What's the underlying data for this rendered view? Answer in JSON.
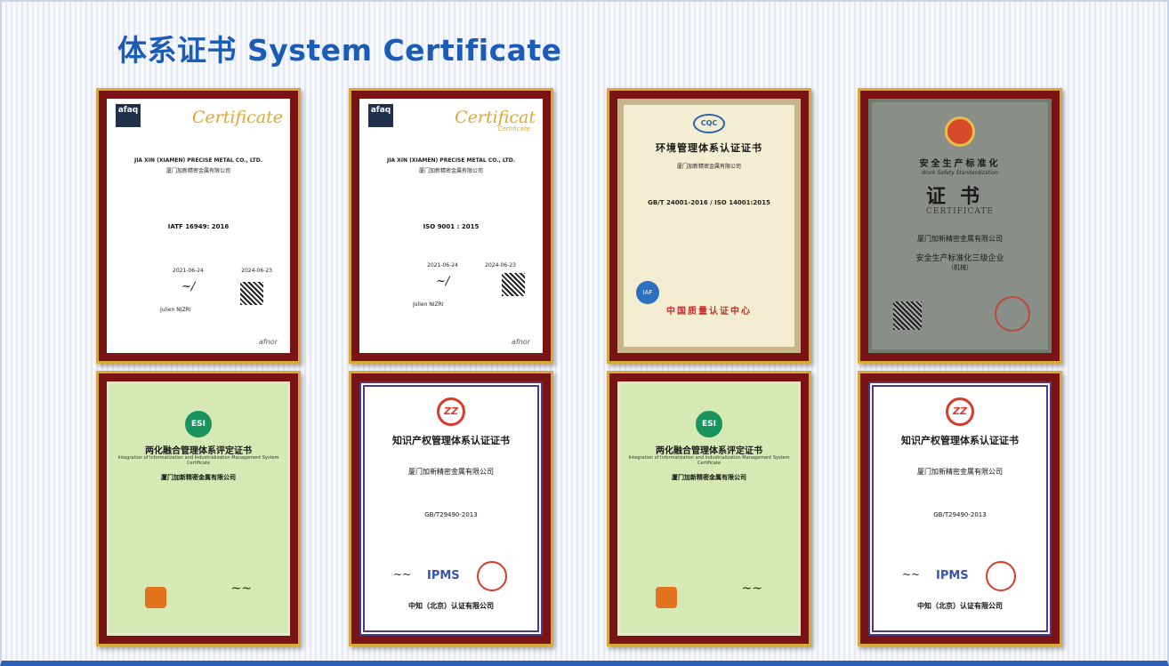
{
  "page": {
    "title": "体系证书 System Certificate"
  },
  "certificates": [
    {
      "issuer_logo": "afaq",
      "heading": "Certificate",
      "heading_sub": "",
      "company_en": "JIA XIN (XIAMEN) PRECISE METAL CO., LTD.",
      "company_cn": "厦门加新精密金属有限公司",
      "standard": "IATF 16949: 2016",
      "date_a": "2021-06-24",
      "date_b": "2024-06-23",
      "signer": "Julien NIZRI",
      "brand": "afnor"
    },
    {
      "issuer_logo": "afaq",
      "heading": "Certificat",
      "heading_sub": "Certificate",
      "company_en": "JIA XIN (XIAMEN) PRECISE METAL CO., LTD.",
      "company_cn": "厦门加新精密金属有限公司",
      "standard": "ISO 9001 : 2015",
      "date_a": "2021-06-24",
      "date_b": "2024-06-23",
      "signer": "Julien NIZRI",
      "brand": "afnor"
    },
    {
      "badge": "CQC",
      "heading": "环境管理体系认证证书",
      "company_cn": "厦门加新精密金属有限公司",
      "standard": "GB/T 24001-2016 / ISO 14001:2015",
      "mark": "IAF",
      "footer": "中国质量认证中心"
    },
    {
      "heading": "安全生产标准化",
      "heading_en": "Work Safety Standardization",
      "title_cn": "证书",
      "title_en": "CERTIFICATE",
      "company_cn": "厦门加新精密金属有限公司",
      "level": "安全生产标准化三级企业",
      "level_sub": "（机械）"
    },
    {
      "logo": "ESI",
      "heading": "两化融合管理体系评定证书",
      "heading_en": "Integration of Informatization and Industrialization Management System Certificate",
      "company_cn": "厦门加新精密金属有限公司"
    },
    {
      "logo": "ZZ",
      "heading": "知识产权管理体系认证证书",
      "company_cn": "厦门加新精密金属有限公司",
      "standard": "GB/T29490-2013",
      "mark": "IPMS",
      "footer": "中知（北京）认证有限公司"
    },
    {
      "logo": "ESI",
      "heading": "两化融合管理体系评定证书",
      "heading_en": "Integration of Informatization and Industrialization Management System Certificate",
      "company_cn": "厦门加新精密金属有限公司"
    },
    {
      "logo": "ZZ",
      "heading": "知识产权管理体系认证证书",
      "company_cn": "厦门加新精密金属有限公司",
      "standard": "GB/T29490-2013",
      "mark": "IPMS",
      "footer": "中知（北京）认证有限公司"
    }
  ],
  "colors": {
    "title": "#1b5db6",
    "frame": "#7a1414",
    "frame_border": "#d7a83a"
  }
}
